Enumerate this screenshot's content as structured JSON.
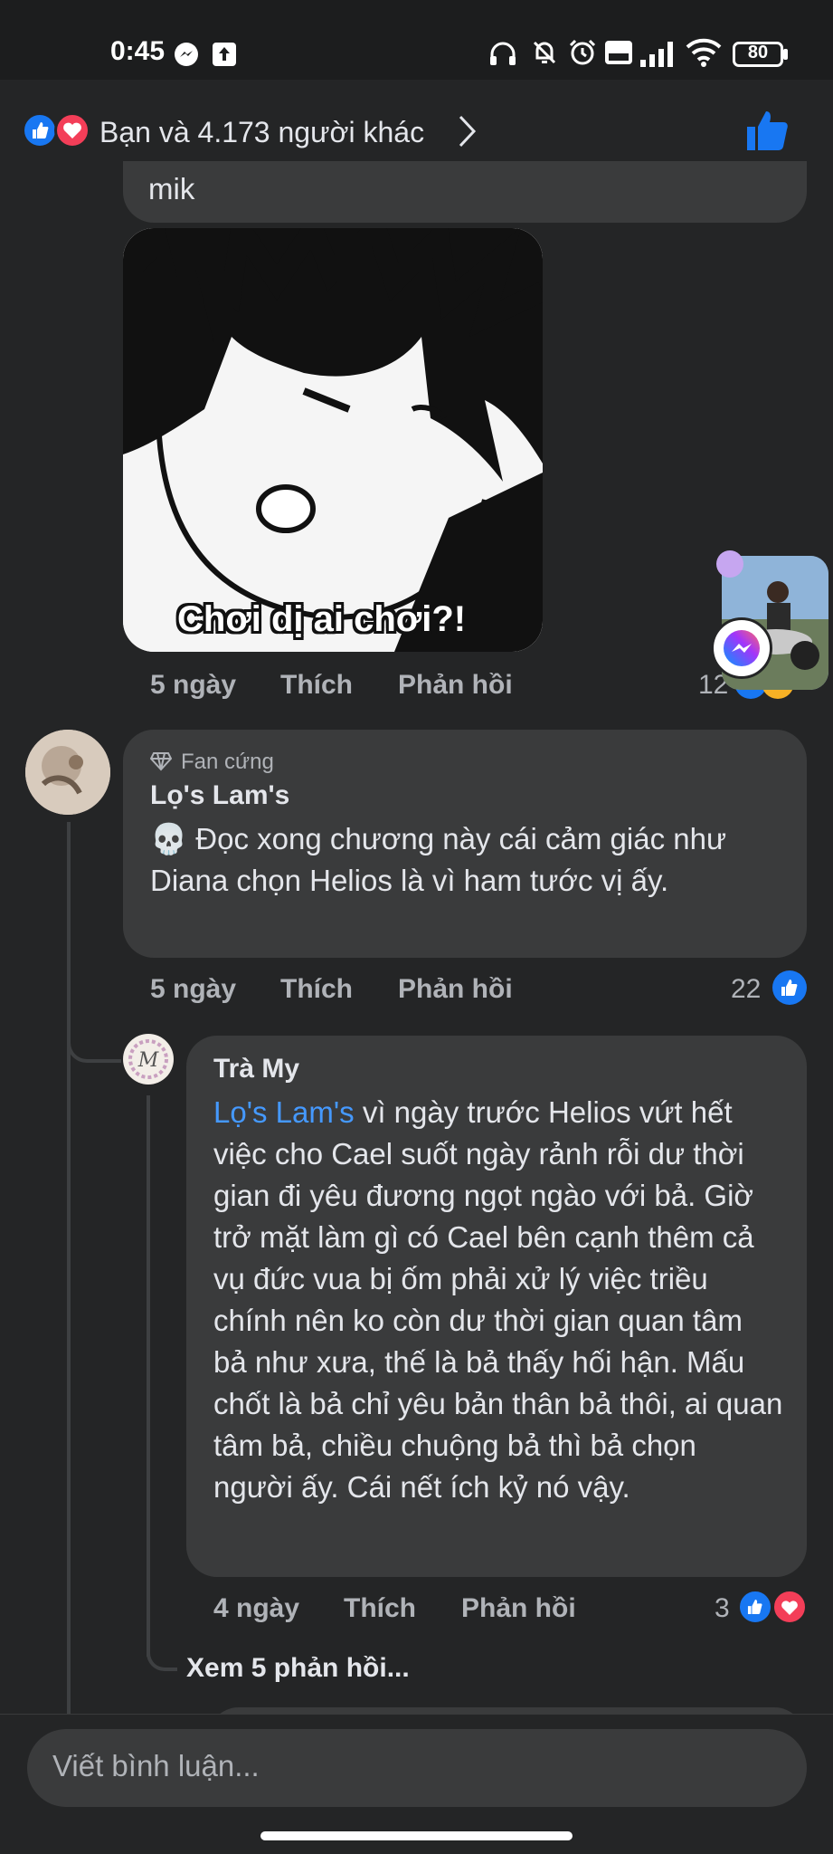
{
  "status_bar": {
    "time": "0:45",
    "battery": "80"
  },
  "header": {
    "reactions_text": "Bạn và 4.173 người khác"
  },
  "comments": [
    {
      "partial_text": "mik",
      "image_caption": "Chơi dị ai chơi?!",
      "time": "5 ngày",
      "like_label": "Thích",
      "reply_label": "Phản hồi",
      "reaction_count": "12"
    },
    {
      "badge": "Fan cứng",
      "author": "Lọ's Lam's",
      "emoji": "💀",
      "text": "Đọc xong chương này cái cảm giác như Diana chọn Helios là vì ham tước vị ấy.",
      "time": "5 ngày",
      "like_label": "Thích",
      "reply_label": "Phản hồi",
      "reaction_count": "22"
    },
    {
      "author": "Trà My",
      "mention": "Lọ's Lam's",
      "text": "vì ngày trước Helios vứt hết việc cho Cael suốt ngày rảnh rỗi dư thời gian đi yêu đương ngọt ngào với bả. Giờ trở mặt làm gì có Cael bên cạnh thêm cả vụ đức vua bị ốm phải xử lý việc triều chính nên ko còn dư thời gian quan tâm bả như xưa, thế là bả thấy hối hận. Mấu chốt là bả chỉ yêu bản thân bả thôi, ai quan tâm bả, chiều chuộng bả thì bả chọn người ấy. Cái nết ích kỷ nó vậy.",
      "time": "4 ngày",
      "like_label": "Thích",
      "reply_label": "Phản hồi",
      "reaction_count": "3",
      "view_replies": "Xem 5 phản hồi..."
    }
  ],
  "composer": {
    "placeholder": "Viết bình luận..."
  },
  "colors": {
    "background": "#242526",
    "bubble": "#3a3b3c",
    "link": "#4599ff",
    "like_blue": "#1877f2",
    "love_red": "#f33e58"
  }
}
